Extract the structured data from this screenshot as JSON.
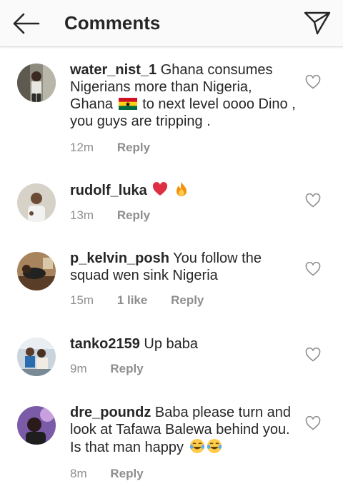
{
  "header": {
    "title": "Comments",
    "back_icon": "arrow-left-icon",
    "share_icon": "paper-plane-icon"
  },
  "colors": {
    "text": "#262626",
    "meta": "#8e8e8e",
    "header_bg": "#fafafa",
    "divider": "#dbdbdb"
  },
  "comments": [
    {
      "username": "water_nist_1",
      "text_before_flag": "Ghana consumes Nigerians more than Nigeria, Ghana",
      "flag": "ghana-flag-emoji",
      "text_after_flag": "to next level oooo Dino , you guys are tripping .",
      "time": "12m",
      "reply_label": "Reply"
    },
    {
      "username": "rudolf_luka",
      "emojis": [
        "red-heart-emoji",
        "fire-emoji"
      ],
      "time": "13m",
      "reply_label": "Reply"
    },
    {
      "username": "p_kelvin_posh",
      "text": "You follow the squad wen sink Nigeria",
      "time": "15m",
      "likes": "1 like",
      "reply_label": "Reply"
    },
    {
      "username": "tanko2159",
      "text": "Up baba",
      "time": "9m",
      "reply_label": "Reply"
    },
    {
      "username": "dre_poundz",
      "text": "Baba please turn and look at Tafawa Balewa behind you. Is that man happy",
      "emojis": [
        "tears-of-joy-emoji",
        "tears-of-joy-emoji"
      ],
      "time": "8m",
      "reply_label": "Reply"
    }
  ]
}
